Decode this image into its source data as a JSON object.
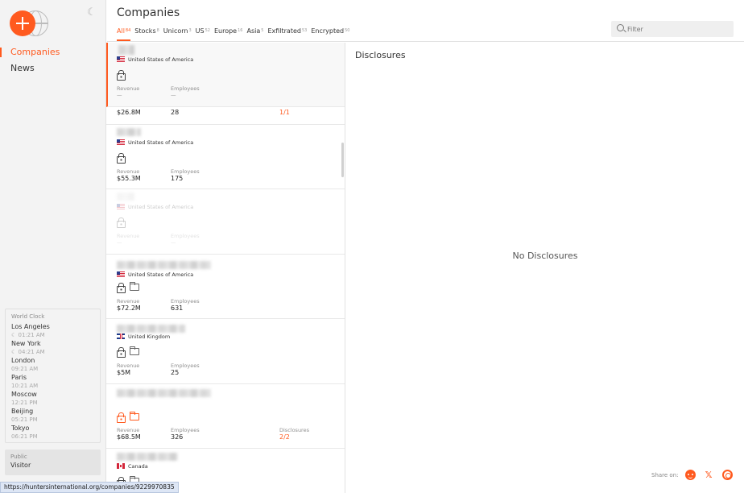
{
  "sidebar": {
    "nav": [
      {
        "label": "Companies",
        "active": true
      },
      {
        "label": "News",
        "active": false
      }
    ],
    "world_clock": {
      "title": "World Clock",
      "cities": [
        {
          "city": "Los Angeles",
          "time": "☾ 01:21 AM"
        },
        {
          "city": "New York",
          "time": "☾ 04:21 AM"
        },
        {
          "city": "London",
          "time": "09:21 AM"
        },
        {
          "city": "Paris",
          "time": "10:21 AM"
        },
        {
          "city": "Moscow",
          "time": "12:21 PM"
        },
        {
          "city": "Beijing",
          "time": "05:21 PM"
        },
        {
          "city": "Tokyo",
          "time": "06:21 PM"
        }
      ]
    },
    "user": {
      "role": "Public",
      "name": "Visitor"
    }
  },
  "header": {
    "title": "Companies",
    "tabs": [
      {
        "label": "All",
        "count": "84",
        "active": true
      },
      {
        "label": "Stocks",
        "count": "8"
      },
      {
        "label": "Unicorn",
        "count": "3"
      },
      {
        "label": "US",
        "count": "52"
      },
      {
        "label": "Europe",
        "count": "16"
      },
      {
        "label": "Asia",
        "count": "5"
      },
      {
        "label": "Exfiltrated",
        "count": "53"
      },
      {
        "label": "Encrypted",
        "count": "50"
      }
    ],
    "filter_placeholder": "Filter"
  },
  "list": {
    "cards": [
      {
        "country": "United States of America",
        "revenue_label": "Revenue",
        "revenue": "—",
        "employees_label": "Employees",
        "employees": "—"
      },
      {
        "revenue": "$26.8M",
        "employees": "28",
        "disclosures": "1/1"
      },
      {
        "country": "United States of America",
        "revenue_label": "Revenue",
        "revenue": "$55.3M",
        "employees_label": "Employees",
        "employees": "175"
      },
      {
        "country": "United States of America",
        "revenue_label": "Revenue",
        "revenue": "—",
        "employees_label": "Employees",
        "employees": "—"
      },
      {
        "country": "United States of America",
        "revenue_label": "Revenue",
        "revenue": "$72.2M",
        "employees_label": "Employees",
        "employees": "631"
      },
      {
        "country": "United Kingdom",
        "revenue_label": "Revenue",
        "revenue": "$5M",
        "employees_label": "Employees",
        "employees": "25"
      },
      {
        "revenue_label": "Revenue",
        "revenue": "$68.5M",
        "employees_label": "Employees",
        "employees": "326",
        "disclosures_label": "Disclosures",
        "disclosures": "2/2"
      },
      {
        "country": "Canada"
      }
    ]
  },
  "detail": {
    "title": "Disclosures",
    "empty_text": "No Disclosures",
    "share_label": "Share on:"
  },
  "status_url": "https://huntersinternational.org/companies/9229970835",
  "colors": {
    "accent": "#ff5a1f"
  }
}
